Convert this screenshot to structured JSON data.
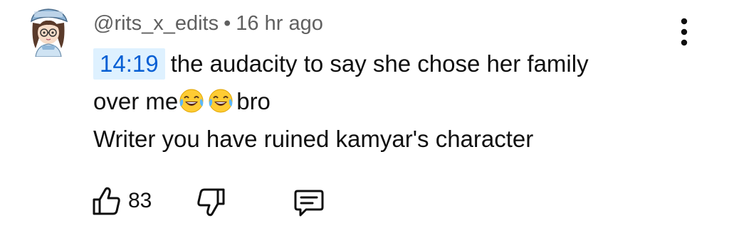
{
  "comment": {
    "author": "@rits_x_edits",
    "separator": "•",
    "time": "16 hr ago",
    "timestamp_link": "14:19",
    "text_line1": "the audacity to say she chose her family",
    "text_line2_start": "over me",
    "emoji": "😂",
    "text_line2_end": "bro",
    "text_line3": "Writer you have ruined kamyar's character"
  },
  "actions": {
    "like_count": "83",
    "like_icon": "thumbs-up-icon",
    "dislike_icon": "thumbs-down-icon",
    "reply_icon": "comment-icon",
    "menu_icon": "more-vertical-icon"
  },
  "colors": {
    "timestamp_bg": "#def1ff",
    "timestamp_text": "#065fd4",
    "meta_text": "#606060",
    "body_text": "#0f0f0f"
  }
}
